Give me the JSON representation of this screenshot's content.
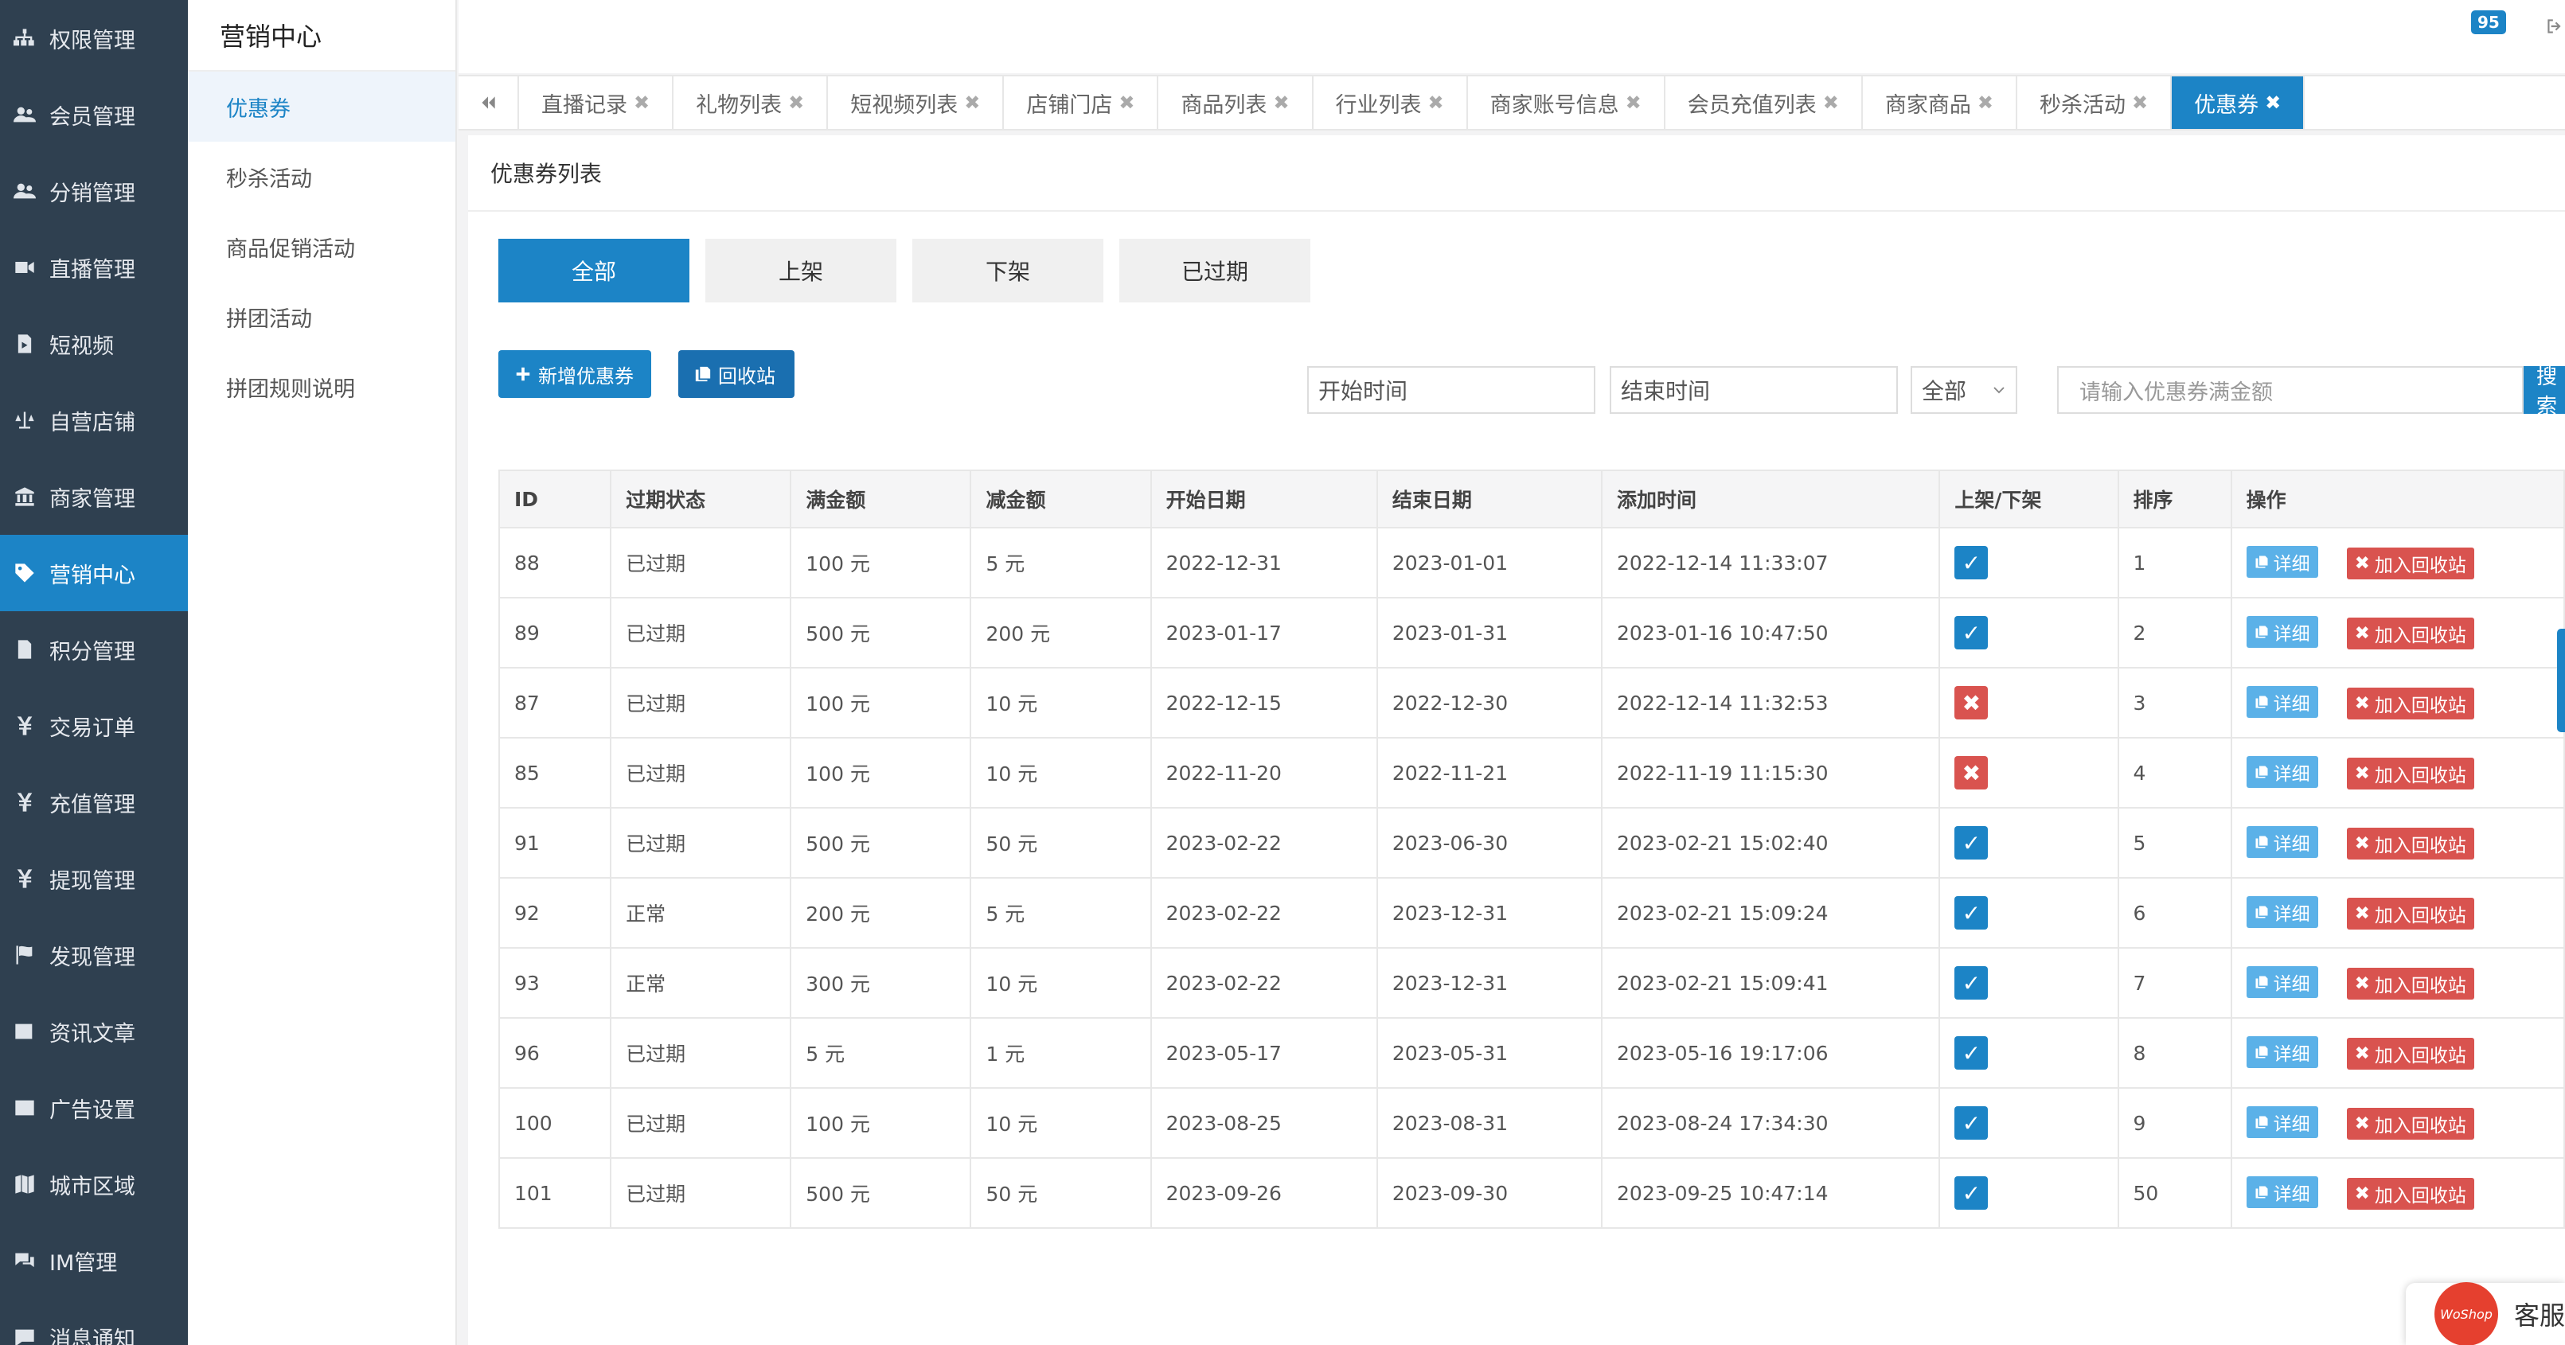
{
  "sidebar": {
    "items": [
      {
        "label": "权限管理",
        "icon": "sitemap-icon"
      },
      {
        "label": "会员管理",
        "icon": "users-icon"
      },
      {
        "label": "分销管理",
        "icon": "users-icon"
      },
      {
        "label": "直播管理",
        "icon": "video-icon"
      },
      {
        "label": "短视频",
        "icon": "file-video-icon"
      },
      {
        "label": "自营店铺",
        "icon": "balance-scale-icon"
      },
      {
        "label": "商家管理",
        "icon": "bank-icon"
      },
      {
        "label": "营销中心",
        "icon": "tag-icon",
        "active": true
      },
      {
        "label": "积分管理",
        "icon": "file-icon"
      },
      {
        "label": "交易订单",
        "icon": "yen-icon"
      },
      {
        "label": "充值管理",
        "icon": "yen-icon"
      },
      {
        "label": "提现管理",
        "icon": "yen-icon"
      },
      {
        "label": "发现管理",
        "icon": "flag-icon"
      },
      {
        "label": "资讯文章",
        "icon": "newspaper-icon"
      },
      {
        "label": "广告设置",
        "icon": "image-icon"
      },
      {
        "label": "城市区域",
        "icon": "map-icon"
      },
      {
        "label": "IM管理",
        "icon": "comments-icon"
      },
      {
        "label": "消息通知",
        "icon": "comment-icon"
      }
    ]
  },
  "submenu": {
    "title": "营销中心",
    "items": [
      "优惠券",
      "秒杀活动",
      "商品促销活动",
      "拼团活动",
      "拼团规则说明"
    ]
  },
  "topbar": {
    "badge": "95"
  },
  "tabs": [
    "直播记录",
    "礼物列表",
    "短视频列表",
    "店铺门店",
    "商品列表",
    "行业列表",
    "商家账号信息",
    "会员充值列表",
    "商家商品",
    "秒杀活动",
    "优惠券"
  ],
  "panel": {
    "title": "优惠券列表",
    "filter_tabs": [
      "全部",
      "上架",
      "下架",
      "已过期"
    ],
    "add_button": "新增优惠券",
    "recycle_button": "回收站",
    "start_placeholder": "开始时间",
    "end_placeholder": "结束时间",
    "select_value": "全部",
    "amount_placeholder": "请输入优惠券满金额",
    "search_button": "搜索"
  },
  "table": {
    "headers": [
      "ID",
      "过期状态",
      "满金额",
      "减金额",
      "开始日期",
      "结束日期",
      "添加时间",
      "上架/下架",
      "排序",
      "操作"
    ],
    "detail_label": "详细",
    "recycle_label": "加入回收站",
    "rows": [
      {
        "id": "88",
        "status": "已过期",
        "full": "100 元",
        "minus": "5 元",
        "start": "2022-12-31",
        "end": "2023-01-01",
        "added": "2022-12-14 11:33:07",
        "on": true,
        "sort": "1"
      },
      {
        "id": "89",
        "status": "已过期",
        "full": "500 元",
        "minus": "200 元",
        "start": "2023-01-17",
        "end": "2023-01-31",
        "added": "2023-01-16 10:47:50",
        "on": true,
        "sort": "2"
      },
      {
        "id": "87",
        "status": "已过期",
        "full": "100 元",
        "minus": "10 元",
        "start": "2022-12-15",
        "end": "2022-12-30",
        "added": "2022-12-14 11:32:53",
        "on": false,
        "sort": "3"
      },
      {
        "id": "85",
        "status": "已过期",
        "full": "100 元",
        "minus": "10 元",
        "start": "2022-11-20",
        "end": "2022-11-21",
        "added": "2022-11-19 11:15:30",
        "on": false,
        "sort": "4"
      },
      {
        "id": "91",
        "status": "已过期",
        "full": "500 元",
        "minus": "50 元",
        "start": "2023-02-22",
        "end": "2023-06-30",
        "added": "2023-02-21 15:02:40",
        "on": true,
        "sort": "5"
      },
      {
        "id": "92",
        "status": "正常",
        "full": "200 元",
        "minus": "5 元",
        "start": "2023-02-22",
        "end": "2023-12-31",
        "added": "2023-02-21 15:09:24",
        "on": true,
        "sort": "6"
      },
      {
        "id": "93",
        "status": "正常",
        "full": "300 元",
        "minus": "10 元",
        "start": "2023-02-22",
        "end": "2023-12-31",
        "added": "2023-02-21 15:09:41",
        "on": true,
        "sort": "7"
      },
      {
        "id": "96",
        "status": "已过期",
        "full": "5 元",
        "minus": "1 元",
        "start": "2023-05-17",
        "end": "2023-05-31",
        "added": "2023-05-16 19:17:06",
        "on": true,
        "sort": "8"
      },
      {
        "id": "100",
        "status": "已过期",
        "full": "100 元",
        "minus": "10 元",
        "start": "2023-08-25",
        "end": "2023-08-31",
        "added": "2023-08-24 17:34:30",
        "on": true,
        "sort": "9"
      },
      {
        "id": "101",
        "status": "已过期",
        "full": "500 元",
        "minus": "50 元",
        "start": "2023-09-26",
        "end": "2023-09-30",
        "added": "2023-09-25 10:47:14",
        "on": true,
        "sort": "50"
      }
    ]
  },
  "chat": {
    "logo": "WoShop",
    "label": "客服"
  },
  "colors": {
    "sidebar_bg": "#2f4050",
    "accent": "#1c84c6",
    "danger": "#d9534f",
    "expired": "#e03a3a"
  }
}
